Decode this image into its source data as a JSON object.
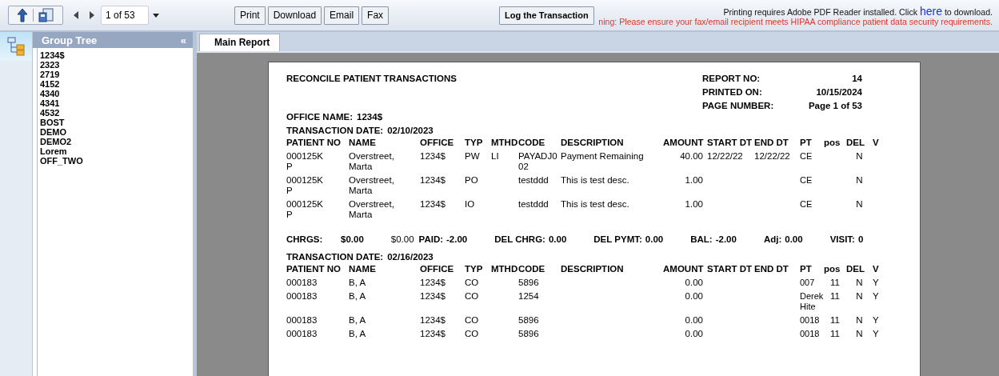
{
  "toolbar": {
    "page_field": {
      "value": "1 of 53"
    },
    "buttons": [
      "Print",
      "Download",
      "Email",
      "Fax"
    ],
    "log_button": "Log the Transaction",
    "notice": {
      "before": "Printing requires Adobe PDF Reader installed. Click",
      "link": "here",
      "after": "to download."
    },
    "warning": "ning: Please ensure your fax/email recipient meets HIPAA compliance patient data security requirements."
  },
  "group_tree": {
    "title": "Group Tree",
    "collapse": "«",
    "items": [
      "1234$",
      "2323",
      "2719",
      "4152",
      "4340",
      "4341",
      "4532",
      "BOST",
      "DEMO",
      "DEMO2",
      "Lorem",
      "OFF_TWO"
    ]
  },
  "tabs": [
    {
      "label": "Main Report",
      "selected": true
    }
  ],
  "report": {
    "title": "RECONCILE PATIENT TRANSACTIONS",
    "meta": [
      {
        "label": "REPORT NO:",
        "value": "14"
      },
      {
        "label": "PRINTED ON:",
        "value": "10/15/2024"
      },
      {
        "label": "PAGE NUMBER:",
        "value": "Page 1 of 53"
      }
    ],
    "office_name": {
      "label": "OFFICE NAME:",
      "value": "1234$"
    },
    "sections": [
      {
        "date_label": "TRANSACTION DATE:",
        "date": "02/10/2023",
        "columns": [
          "PATIENT NO",
          "NAME",
          "OFFICE",
          "TYP",
          "MTHD",
          "CODE",
          "DESCRIPTION",
          "AMOUNT",
          "START DT",
          "END DT",
          "PT",
          "pos",
          "DEL",
          "V"
        ],
        "rows": [
          [
            "000125KP",
            "Overstreet, Marta",
            "1234$",
            "PW",
            "LI",
            "PAYADJ002",
            "Payment Remaining",
            "40.00",
            "12/22/22",
            "12/22/22",
            "CE",
            "",
            "N",
            ""
          ],
          [
            "000125KP",
            "Overstreet, Marta",
            "1234$",
            "PO",
            "",
            "testddd",
            "This is test desc.",
            "1.00",
            "",
            "",
            "CE",
            "",
            "N",
            ""
          ],
          [
            "000125KP",
            "Overstreet, Marta",
            "1234$",
            "IO",
            "",
            "testddd",
            "This is test desc.",
            "1.00",
            "",
            "",
            "CE",
            "",
            "N",
            ""
          ]
        ],
        "summary": [
          {
            "label": "CHRGS:",
            "value": "$0.00"
          },
          {
            "value": "$0.00"
          },
          {
            "label": "PAID:",
            "value": "-2.00"
          },
          {
            "label": "DEL CHRG:",
            "value": "0.00"
          },
          {
            "label": "DEL PYMT:",
            "value": "0.00"
          },
          {
            "label": "BAL:",
            "value": "-2.00"
          },
          {
            "label": "Adj:",
            "value": "0.00"
          },
          {
            "label": "VISIT:",
            "value": "0"
          }
        ]
      },
      {
        "date_label": "TRANSACTION DATE:",
        "date": "02/16/2023",
        "columns": [
          "PATIENT NO",
          "NAME",
          "OFFICE",
          "TYP",
          "MTHD",
          "CODE",
          "DESCRIPTION",
          "AMOUNT",
          "START DT",
          "END DT",
          "PT",
          "pos",
          "DEL",
          "V"
        ],
        "rows": [
          [
            "000183",
            "B, A",
            "1234$",
            "CO",
            "",
            "5896",
            "",
            "0.00",
            "",
            "",
            "007",
            "11",
            "N",
            "Y"
          ],
          [
            "000183",
            "B, A",
            "1234$",
            "CO",
            "",
            "1254",
            "",
            "0.00",
            "",
            "",
            "DerekHite",
            "11",
            "N",
            "Y"
          ],
          [
            "000183",
            "B, A",
            "1234$",
            "CO",
            "",
            "5896",
            "",
            "0.00",
            "",
            "",
            "0018",
            "11",
            "N",
            "Y"
          ],
          [
            "000183",
            "B, A",
            "1234$",
            "CO",
            "",
            "5896",
            "",
            "0.00",
            "",
            "",
            "0018",
            "11",
            "N",
            "Y"
          ]
        ]
      }
    ]
  }
}
